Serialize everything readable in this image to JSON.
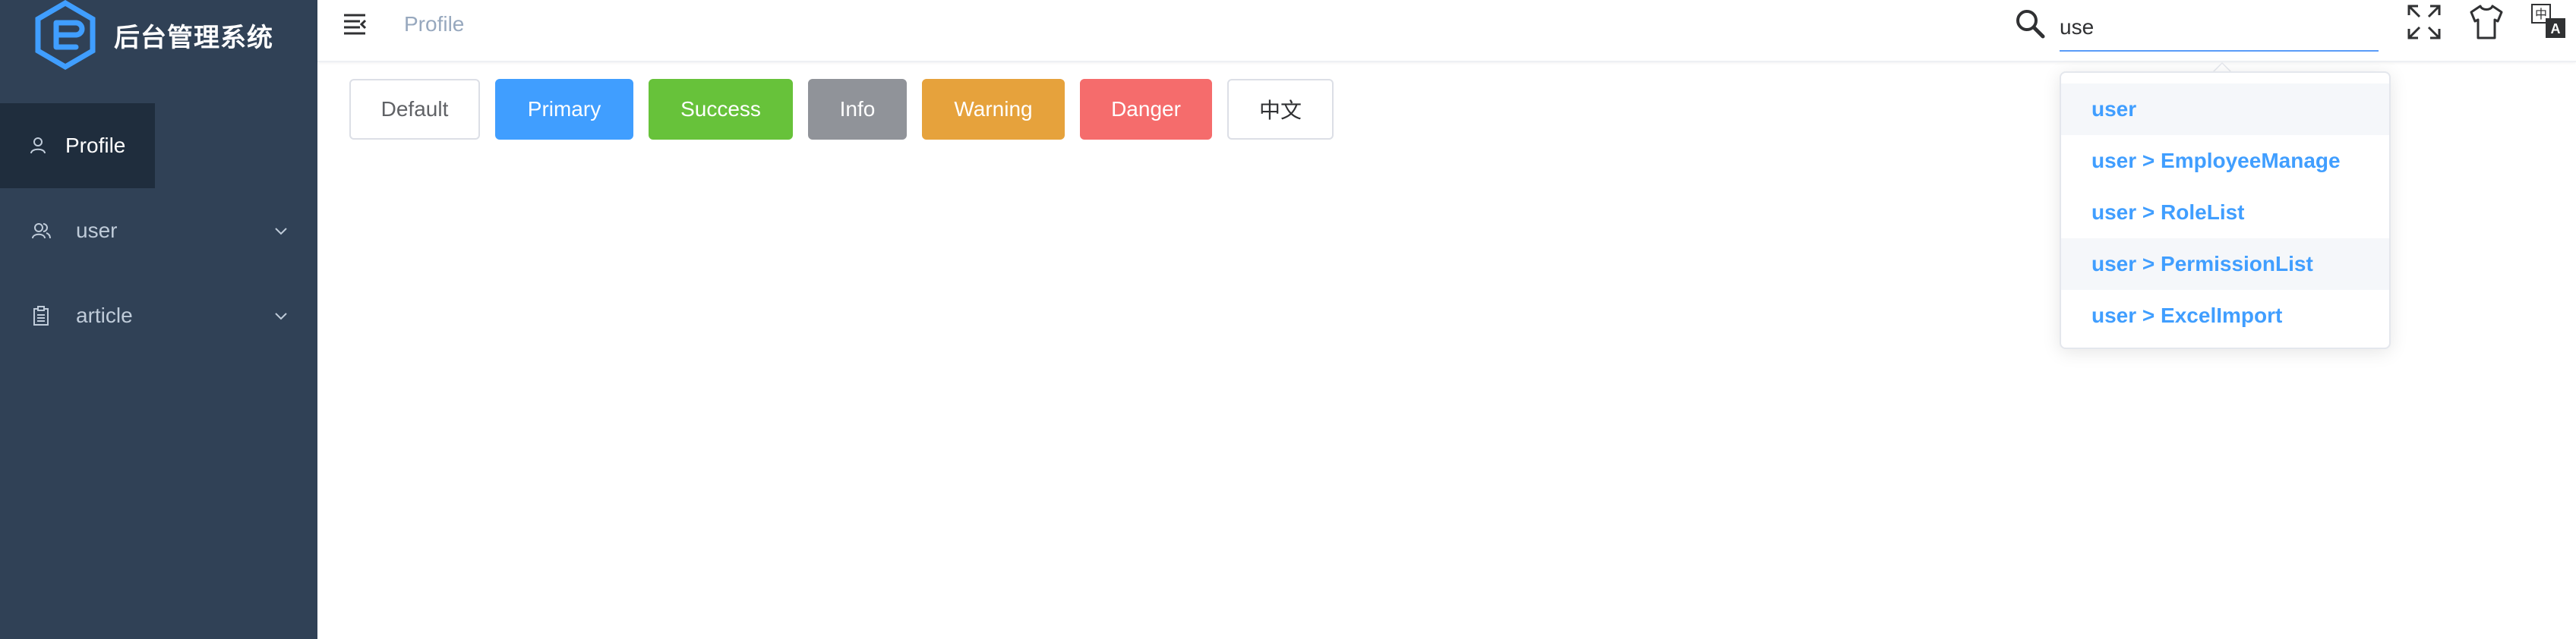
{
  "app": {
    "title": "后台管理系统"
  },
  "sidebar": {
    "items": [
      {
        "label": "Profile",
        "icon": "user-icon",
        "active": true
      },
      {
        "label": "user",
        "icon": "users-icon",
        "has_children": true
      },
      {
        "label": "article",
        "icon": "clipboard-icon",
        "has_children": true
      }
    ]
  },
  "navbar": {
    "breadcrumb": "Profile",
    "search": {
      "value": "use",
      "placeholder": ""
    },
    "icons": [
      "search-icon",
      "fullscreen-icon",
      "theme-shirt-icon",
      "language-icon"
    ]
  },
  "search_results": [
    "user",
    "user > EmployeeManage",
    "user > RoleList",
    "user > PermissionList",
    "user > ExcelImport"
  ],
  "buttons": {
    "default": "Default",
    "primary": "Primary",
    "success": "Success",
    "info": "Info",
    "warning": "Warning",
    "danger": "Danger",
    "lang": "中文"
  },
  "colors": {
    "sidebar_bg": "#304156",
    "primary": "#409eff",
    "success": "#67c23a",
    "info": "#909399",
    "warning": "#e6a23c",
    "danger": "#f56c6c"
  }
}
